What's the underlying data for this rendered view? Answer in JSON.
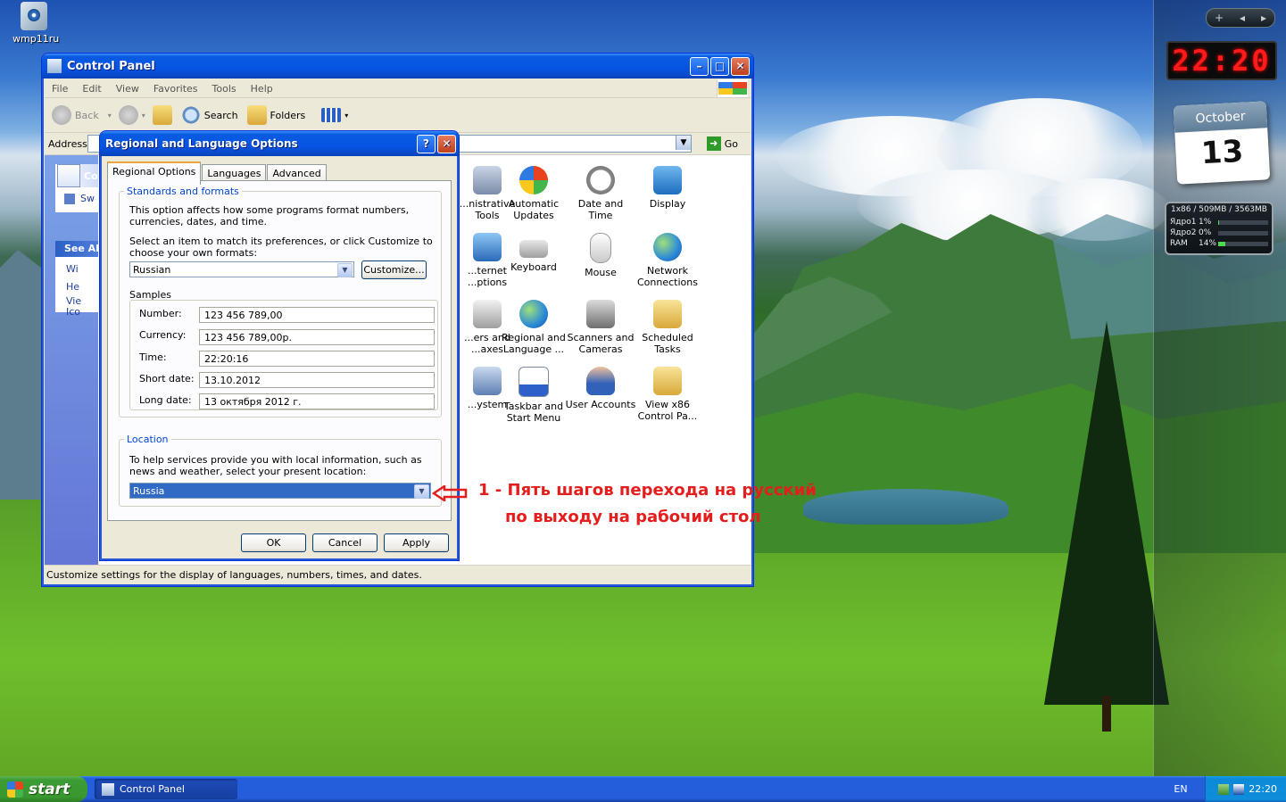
{
  "desktop": {
    "icon_label": "wmp11ru"
  },
  "gadgets": {
    "clock": "22:20",
    "calendar_month": "October",
    "calendar_day": "13",
    "cpu_header": "1x86 / 509MB / 3563MB",
    "cpu_rows": [
      {
        "label": "Ядро1",
        "percent": "1%",
        "value": 1
      },
      {
        "label": "Ядро2",
        "percent": "0%",
        "value": 0
      },
      {
        "label": "RAM",
        "percent": "14%",
        "value": 14
      }
    ],
    "controls": [
      "+",
      "◂",
      "▸"
    ]
  },
  "control_panel": {
    "title": "Control Panel",
    "menu": [
      "File",
      "Edit",
      "View",
      "Favorites",
      "Tools",
      "Help"
    ],
    "toolbar": {
      "back": "Back",
      "search": "Search",
      "folders": "Folders"
    },
    "address_label": "Address",
    "go_label": "Go",
    "left_panel": {
      "task_label": "Co",
      "task_item": "Sw",
      "see_also": "See Al",
      "links": [
        "Wi",
        "He",
        "Vie Ico"
      ]
    },
    "items": [
      {
        "label": "...nistrative Tools",
        "partial": true
      },
      {
        "label": "Automatic Updates"
      },
      {
        "label": "Date and Time"
      },
      {
        "label": "Display"
      },
      {
        "label": "...ternet ...ptions",
        "partial": true
      },
      {
        "label": "Keyboard"
      },
      {
        "label": "Mouse"
      },
      {
        "label": "Network Connections"
      },
      {
        "label": "...ers and ...axes",
        "partial": true
      },
      {
        "label": "Regional and Language ..."
      },
      {
        "label": "Scanners and Cameras"
      },
      {
        "label": "Scheduled Tasks"
      },
      {
        "label": "...ystem",
        "partial": true
      },
      {
        "label": "Taskbar and Start Menu"
      },
      {
        "label": "User Accounts"
      },
      {
        "label": "View x86 Control Pa..."
      }
    ],
    "status_text": "Customize settings for the display of languages, numbers, times, and dates."
  },
  "dialog": {
    "title": "Regional and Language Options",
    "tabs": [
      "Regional Options",
      "Languages",
      "Advanced"
    ],
    "standards_legend": "Standards and formats",
    "standards_desc": "This option affects how some programs format numbers, currencies, dates, and time.",
    "select_desc": "Select an item to match its preferences, or click Customize to choose your own formats:",
    "format_value": "Russian",
    "customize_label": "Customize...",
    "samples_label": "Samples",
    "samples": [
      {
        "label": "Number:",
        "value": "123 456 789,00"
      },
      {
        "label": "Currency:",
        "value": "123 456 789,00р."
      },
      {
        "label": "Time:",
        "value": "22:20:16"
      },
      {
        "label": "Short date:",
        "value": "13.10.2012"
      },
      {
        "label": "Long date:",
        "value": "13 октября 2012 г."
      }
    ],
    "location_legend": "Location",
    "location_desc": "To help services provide you with local information, such as news and weather, select your present location:",
    "location_value": "Russia",
    "ok_label": "OK",
    "cancel_label": "Cancel",
    "apply_label": "Apply"
  },
  "annotation": {
    "line1": "1 - Пять шагов перехода на русский",
    "line2": "по выходу  на рабочий стол",
    "color": "#e41d1d"
  },
  "taskbar": {
    "start_label": "start",
    "task_label": "Control Panel",
    "language": "EN",
    "time": "22:20"
  },
  "colors": {
    "xp_blue": "#0554e3",
    "start_green": "#3c9c35",
    "selection": "#316ac5"
  }
}
